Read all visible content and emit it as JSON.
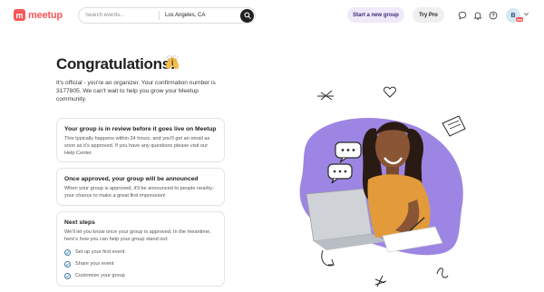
{
  "header": {
    "logo_text": "meetup",
    "search_placeholder": "Search events...",
    "location": "Los Angeles, CA",
    "start_group_label": "Start a new group",
    "try_pro_label": "Try Pro",
    "avatar_initial": "B",
    "pro_badge": "PRO"
  },
  "main": {
    "title": "Congratulations!",
    "intro": "It's official - you're an organizer. Your confirmation number is 3177805. We can't wait to help you grow your Meetup community.",
    "cards": [
      {
        "title": "Your group is in review before it goes live on Meetup",
        "body": "This typically happens within 24 hours, and you'll get an email as soon as it's approved. If you have any questions please visit our Help Center."
      },
      {
        "title": "Once approved, your group will be announced",
        "body": "When your group is approved, it'll be announced to people nearby-your chance to make a great first impression!"
      },
      {
        "title": "Next steps",
        "body": "We'll let you know once your group is approved. In the meantime, here's how you can help your group stand out:",
        "steps": [
          "Set up your first event",
          "Share your event",
          "Customize your group"
        ]
      }
    ]
  },
  "colors": {
    "brand": "#f65858",
    "illustration_purple": "#9d86e3",
    "link_blue": "#3b7ba8"
  },
  "icons": [
    "search-icon",
    "chat-icon",
    "bell-icon",
    "help-icon",
    "chevron-down-icon",
    "raising-hands-icon",
    "check-circle-icon"
  ]
}
